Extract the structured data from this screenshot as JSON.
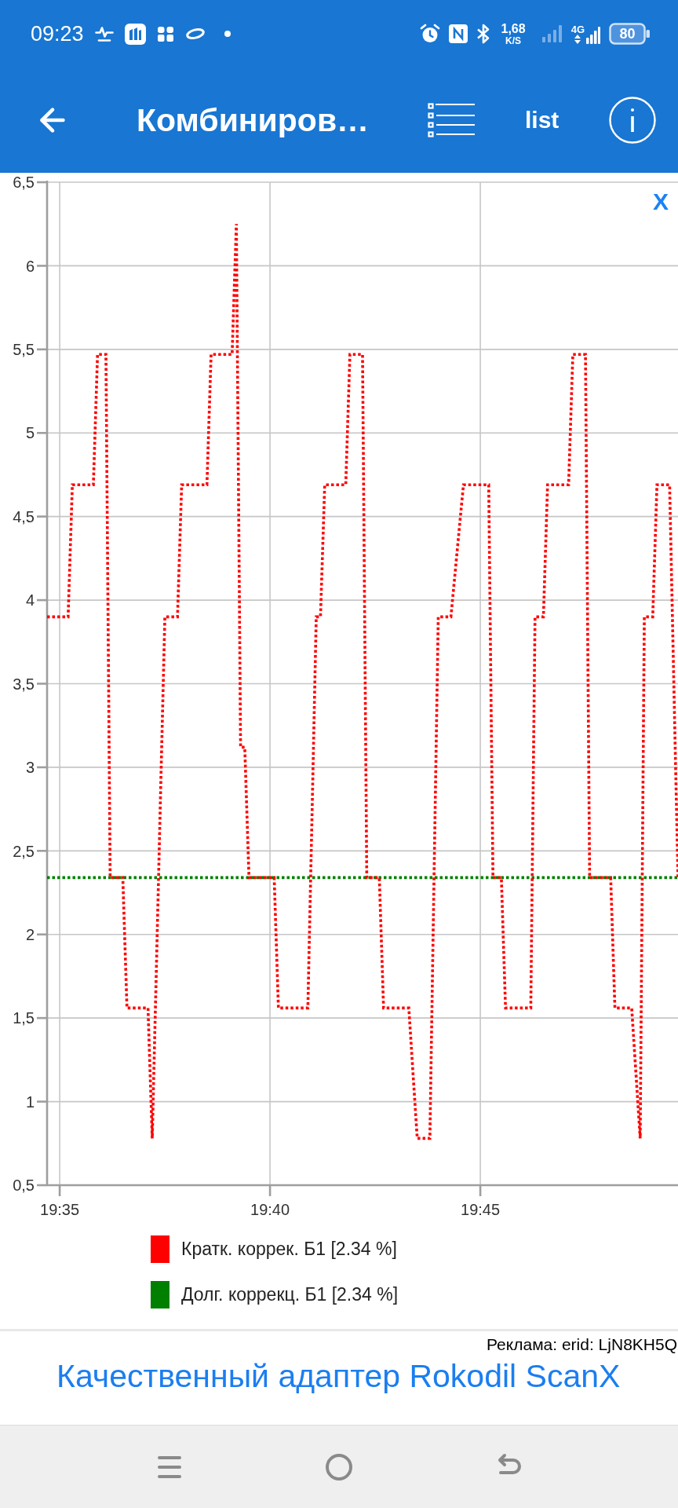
{
  "status_bar": {
    "time": "09:23",
    "net_speed": "1,68",
    "net_speed_unit": "K/S",
    "network_type": "4G",
    "battery": "80"
  },
  "app_bar": {
    "title": "Комбиниров…",
    "list_label": "list"
  },
  "chart": {
    "close_label": "X",
    "chart_data": {
      "type": "line",
      "grid": true,
      "legend": "bottom",
      "categories": [
        null,
        null,
        null,
        "19:35",
        null,
        null,
        null,
        null,
        null,
        null,
        null,
        null,
        null,
        null,
        null,
        null,
        null,
        null,
        null,
        null,
        null,
        null,
        null,
        null,
        null,
        null,
        null,
        null,
        null,
        null,
        null,
        null,
        null,
        null,
        null,
        null,
        null,
        null,
        null,
        null,
        null,
        null,
        null,
        null,
        null,
        null,
        null,
        null,
        null,
        null,
        null,
        null,
        null,
        "19:40",
        null,
        null,
        null,
        null,
        null,
        null,
        null,
        null,
        null,
        null,
        null,
        null,
        null,
        null,
        null,
        null,
        null,
        null,
        null,
        null,
        null,
        null,
        null,
        null,
        null,
        null,
        null,
        null,
        null,
        null,
        null,
        null,
        null,
        null,
        null,
        null,
        null,
        null,
        null,
        null,
        null,
        null,
        null,
        null,
        null,
        null,
        null,
        null,
        null,
        "19:45",
        null,
        null,
        null,
        null,
        null,
        null,
        null,
        null,
        null,
        null,
        null,
        null,
        null,
        null,
        null,
        null,
        null,
        null,
        null,
        null,
        null,
        null,
        null,
        null,
        null,
        null,
        null,
        null,
        null,
        null,
        null,
        null,
        null,
        null,
        null,
        null,
        null,
        null,
        null,
        null,
        null,
        null,
        null,
        null,
        null,
        null,
        null
      ],
      "series": [
        {
          "name": "Кратк. коррек. Б1 [2.34 %]",
          "color": "#ff0000",
          "line_style": "dotted",
          "values": [
            3.9,
            3.9,
            3.9,
            3.9,
            3.9,
            3.9,
            4.69,
            4.69,
            4.69,
            4.69,
            4.69,
            4.69,
            5.47,
            5.47,
            5.47,
            2.34,
            2.34,
            2.34,
            2.34,
            1.56,
            1.56,
            1.56,
            1.56,
            1.56,
            1.56,
            0.78,
            1.82,
            2.86,
            3.9,
            3.9,
            3.9,
            3.9,
            4.69,
            4.69,
            4.69,
            4.69,
            4.69,
            4.69,
            4.69,
            5.47,
            5.47,
            5.47,
            5.47,
            5.47,
            5.47,
            6.25,
            3.12,
            3.12,
            2.34,
            2.34,
            2.34,
            2.34,
            2.34,
            2.34,
            2.34,
            1.56,
            1.56,
            1.56,
            1.56,
            1.56,
            1.56,
            1.56,
            1.56,
            2.73,
            3.9,
            3.9,
            4.69,
            4.69,
            4.69,
            4.69,
            4.69,
            4.69,
            5.47,
            5.47,
            5.47,
            5.47,
            2.34,
            2.34,
            2.34,
            2.34,
            1.56,
            1.56,
            1.56,
            1.56,
            1.56,
            1.56,
            1.56,
            1.17,
            0.78,
            0.78,
            0.78,
            0.78,
            2.34,
            3.9,
            3.9,
            3.9,
            3.9,
            4.16,
            4.43,
            4.69,
            4.69,
            4.69,
            4.69,
            4.69,
            4.69,
            4.69,
            2.34,
            2.34,
            2.34,
            1.56,
            1.56,
            1.56,
            1.56,
            1.56,
            1.56,
            1.56,
            3.9,
            3.9,
            3.9,
            4.69,
            4.69,
            4.69,
            4.69,
            4.69,
            4.69,
            5.47,
            5.47,
            5.47,
            5.47,
            2.34,
            2.34,
            2.34,
            2.34,
            2.34,
            2.34,
            1.56,
            1.56,
            1.56,
            1.56,
            1.56,
            1.17,
            0.78,
            3.9,
            3.9,
            3.9,
            4.69,
            4.69,
            4.69,
            4.69,
            3.52,
            2.34
          ]
        },
        {
          "name": "Долг. коррекц. Б1 [2.34 %]",
          "color": "#008000",
          "line_style": "dotted",
          "values": [
            2.34,
            2.34,
            2.34,
            2.34,
            2.34,
            2.34,
            2.34,
            2.34,
            2.34,
            2.34,
            2.34,
            2.34,
            2.34,
            2.34,
            2.34,
            2.34,
            2.34,
            2.34,
            2.34,
            2.34,
            2.34,
            2.34,
            2.34,
            2.34,
            2.34,
            2.34,
            2.34,
            2.34,
            2.34,
            2.34,
            2.34,
            2.34,
            2.34,
            2.34,
            2.34,
            2.34,
            2.34,
            2.34,
            2.34,
            2.34,
            2.34,
            2.34,
            2.34,
            2.34,
            2.34,
            2.34,
            2.34,
            2.34,
            2.34,
            2.34,
            2.34,
            2.34,
            2.34,
            2.34,
            2.34,
            2.34,
            2.34,
            2.34,
            2.34,
            2.34,
            2.34,
            2.34,
            2.34,
            2.34,
            2.34,
            2.34,
            2.34,
            2.34,
            2.34,
            2.34,
            2.34,
            2.34,
            2.34,
            2.34,
            2.34,
            2.34,
            2.34,
            2.34,
            2.34,
            2.34,
            2.34,
            2.34,
            2.34,
            2.34,
            2.34,
            2.34,
            2.34,
            2.34,
            2.34,
            2.34,
            2.34,
            2.34,
            2.34,
            2.34,
            2.34,
            2.34,
            2.34,
            2.34,
            2.34,
            2.34,
            2.34,
            2.34,
            2.34,
            2.34,
            2.34,
            2.34,
            2.34,
            2.34,
            2.34,
            2.34,
            2.34,
            2.34,
            2.34,
            2.34,
            2.34,
            2.34,
            2.34,
            2.34,
            2.34,
            2.34,
            2.34,
            2.34,
            2.34,
            2.34,
            2.34,
            2.34,
            2.34,
            2.34,
            2.34,
            2.34,
            2.34,
            2.34,
            2.34,
            2.34,
            2.34,
            2.34,
            2.34,
            2.34,
            2.34,
            2.34,
            2.34,
            2.34,
            2.34,
            2.34,
            2.34,
            2.34,
            2.34,
            2.34,
            2.34,
            2.34,
            2.34
          ]
        }
      ],
      "ylim": [
        0.5,
        6.5
      ],
      "yticks": [
        {
          "value": 0.5,
          "label": "0,5"
        },
        {
          "value": 1,
          "label": "1"
        },
        {
          "value": 1.5,
          "label": "1,5"
        },
        {
          "value": 2,
          "label": "2"
        },
        {
          "value": 2.5,
          "label": "2,5"
        },
        {
          "value": 3,
          "label": "3"
        },
        {
          "value": 3.5,
          "label": "3,5"
        },
        {
          "value": 4,
          "label": "4"
        },
        {
          "value": 4.5,
          "label": "4,5"
        },
        {
          "value": 5,
          "label": "5"
        },
        {
          "value": 5.5,
          "label": "5,5"
        },
        {
          "value": 6,
          "label": "6"
        },
        {
          "value": 6.5,
          "label": "6,5"
        }
      ]
    }
  },
  "ad": {
    "label": "Реклама: erid: LjN8KH5Q",
    "text": "Качественный адаптер Rokodil ScanX"
  }
}
